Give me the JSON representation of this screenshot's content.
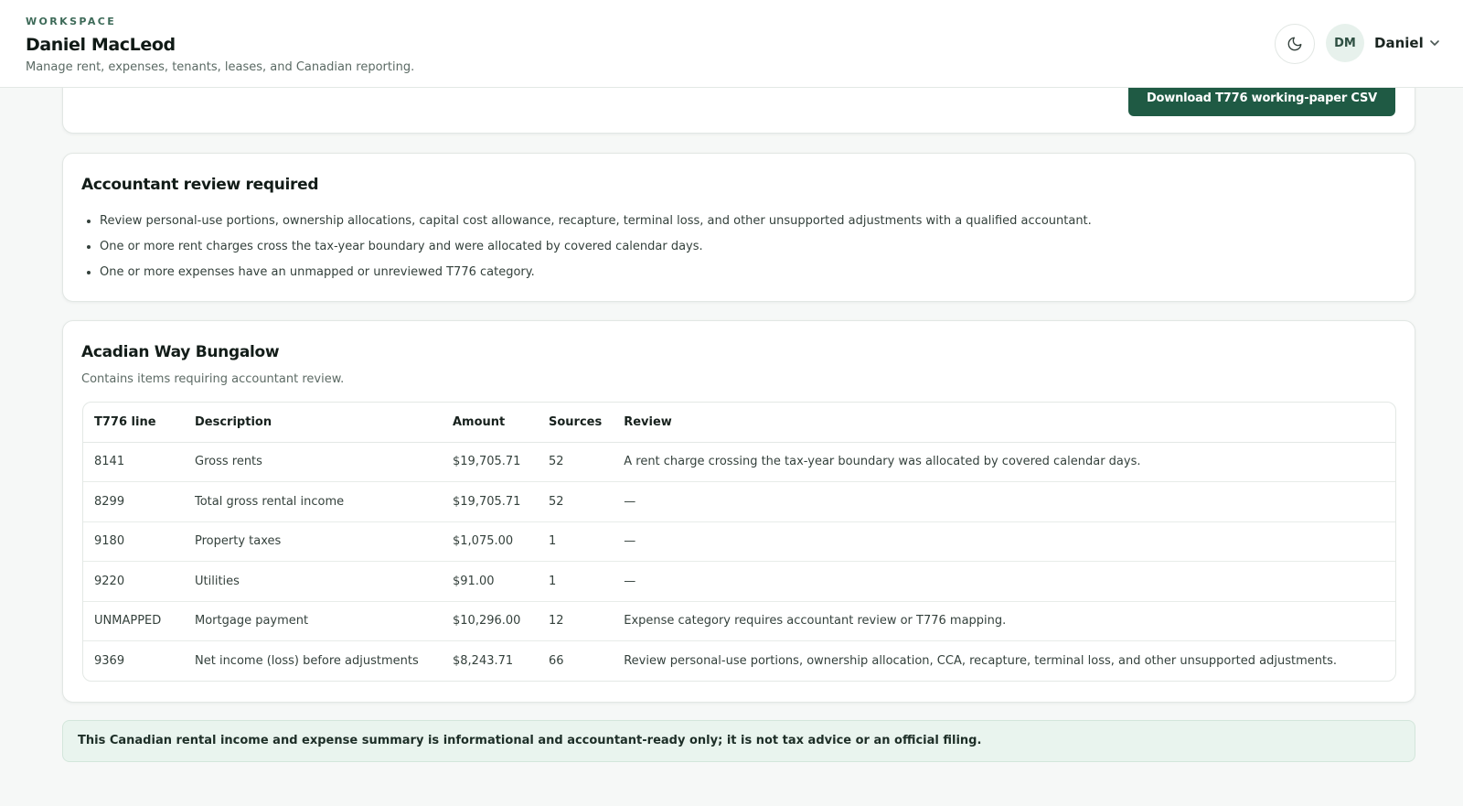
{
  "header": {
    "eyebrow": "WORKSPACE",
    "workspace_name": "Daniel MacLeod",
    "subtitle": "Manage rent, expenses, tenants, leases, and Canadian reporting.",
    "theme_toggle_icon": "moon-icon",
    "avatar_initials": "DM",
    "user_name": "Daniel",
    "menu_icon": "chevron-down-icon"
  },
  "export": {
    "download_label": "Download T776 working-paper CSV"
  },
  "accountant_review": {
    "title": "Accountant review required",
    "items": [
      "Review personal-use portions, ownership allocations, capital cost allowance, recapture, terminal loss, and other unsupported adjustments with a qualified accountant.",
      "One or more rent charges cross the tax-year boundary and were allocated by covered calendar days.",
      "One or more expenses have an unmapped or unreviewed T776 category."
    ]
  },
  "property": {
    "name": "Acadian Way Bungalow",
    "note": "Contains items requiring accountant review.",
    "columns": [
      "T776 line",
      "Description",
      "Amount",
      "Sources",
      "Review"
    ],
    "rows": [
      {
        "line": "8141",
        "description": "Gross rents",
        "amount": "$19,705.71",
        "sources": "52",
        "review": "A rent charge crossing the tax-year boundary was allocated by covered calendar days."
      },
      {
        "line": "8299",
        "description": "Total gross rental income",
        "amount": "$19,705.71",
        "sources": "52",
        "review": "—"
      },
      {
        "line": "9180",
        "description": "Property taxes",
        "amount": "$1,075.00",
        "sources": "1",
        "review": "—"
      },
      {
        "line": "9220",
        "description": "Utilities",
        "amount": "$91.00",
        "sources": "1",
        "review": "—"
      },
      {
        "line": "UNMAPPED",
        "description": "Mortgage payment",
        "amount": "$10,296.00",
        "sources": "12",
        "review": "Expense category requires accountant review or T776 mapping."
      },
      {
        "line": "9369",
        "description": "Net income (loss) before adjustments",
        "amount": "$8,243.71",
        "sources": "66",
        "review": "Review personal-use portions, ownership allocation, CCA, recapture, terminal loss, and other unsupported adjustments."
      }
    ]
  },
  "disclaimer": "This Canadian rental income and expense summary is informational and accountant-ready only; it is not tax advice or an official filing.",
  "colors": {
    "accent": "#1f5a44",
    "notice_bg": "#e9f4ee",
    "avatar_bg": "#e7f1ec"
  }
}
